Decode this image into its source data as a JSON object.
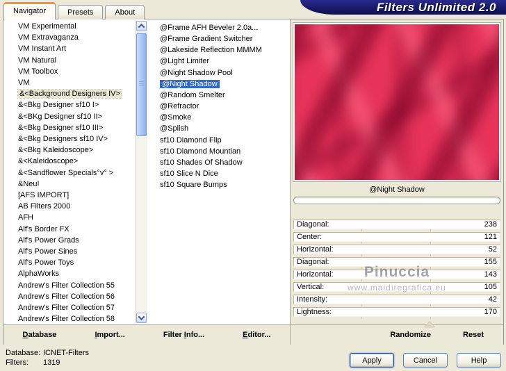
{
  "window": {
    "banner_title": "Filters Unlimited 2.0"
  },
  "tabs": [
    {
      "label": "Navigator",
      "active": true
    },
    {
      "label": "Presets",
      "active": false
    },
    {
      "label": "About",
      "active": false
    }
  ],
  "colors": {
    "dialog_bg": "#ece9d8",
    "banner_navy": "#1c1c78",
    "tab_active_accent": "#f0953c",
    "selection_blue": "#316ac5",
    "inactive_selection": "#e9e6d2",
    "preview_red": "#e7335a",
    "preview_dark_red": "#820528"
  },
  "category_list": {
    "selected_index": 6,
    "items": [
      "VM Experimental",
      "VM Extravaganza",
      "VM Instant Art",
      "VM Natural",
      "VM Toolbox",
      "VM",
      "&<Background Designers IV>",
      "&<Bkg Designer sf10 I>",
      "&<BKg Designer sf10 II>",
      "&<Bkg Designer sf10 III>",
      "&<Bkg Designers sf10 IV>",
      "&<Bkg Kaleidoscope>",
      "&<Kaleidoscope>",
      "&<Sandflower Specials°v° >",
      "&Neu!",
      "[AFS IMPORT]",
      "AB Filters 2000",
      "AFH",
      "Alf's Border FX",
      "Alf's Power Grads",
      "Alf's Power Sines",
      "Alf's Power Toys",
      "AlphaWorks",
      "Andrew's Filter Collection 55",
      "Andrew's Filter Collection 56",
      "Andrew's Filter Collection 57",
      "Andrew's Filter Collection 58"
    ]
  },
  "filter_list": {
    "selected_index": 5,
    "items": [
      "@Frame AFH Beveler 2.0a...",
      "@Frame Gradient Switcher",
      "@Lakeside Reflection MMMM",
      "@Light Limiter",
      "@Night Shadow Pool",
      "@Night Shadow",
      "@Random Smelter",
      "@Refractor",
      "@Smoke",
      "@Splish",
      "sf10 Diamond Flip",
      "sf10 Diamond Mountian",
      "sf10 Shades Of Shadow",
      "sf10 Slice N Dice",
      "sf10 Square Bumps"
    ]
  },
  "preview": {
    "selected_filter_label": "@Night Shadow",
    "progress_percent": 0
  },
  "slider_meta": {
    "max": 255
  },
  "sliders": [
    {
      "label": "Diagonal:",
      "value": 238
    },
    {
      "label": "Center:",
      "value": 121
    },
    {
      "label": "Horizontal:",
      "value": 52
    },
    {
      "label": "Diagonal:",
      "value": 155
    },
    {
      "label": "Horizontal:",
      "value": 143
    },
    {
      "label": "Vertical:",
      "value": 105
    },
    {
      "label": "Intensity:",
      "value": 42
    },
    {
      "label": "Lightness:",
      "value": 170
    }
  ],
  "toolbar": {
    "database": {
      "pre": "",
      "key": "D",
      "post": "atabase"
    },
    "import": {
      "pre": "",
      "key": "I",
      "post": "mport..."
    },
    "filter_info": {
      "pre": "Filter ",
      "key": "I",
      "post": "nfo..."
    },
    "editor": {
      "pre": "",
      "key": "E",
      "post": "ditor..."
    },
    "randomize": "Randomize",
    "reset": "Reset"
  },
  "status": {
    "database_label": "Database:",
    "database_value": "ICNET-Filters",
    "filters_label": "Filters:",
    "filters_value": "1319"
  },
  "actions": {
    "apply": "Apply",
    "cancel": "Cancel",
    "help": "Help"
  },
  "watermark": {
    "line1": "Pinuccia",
    "line2": "www.maidiregrafica.eu"
  }
}
